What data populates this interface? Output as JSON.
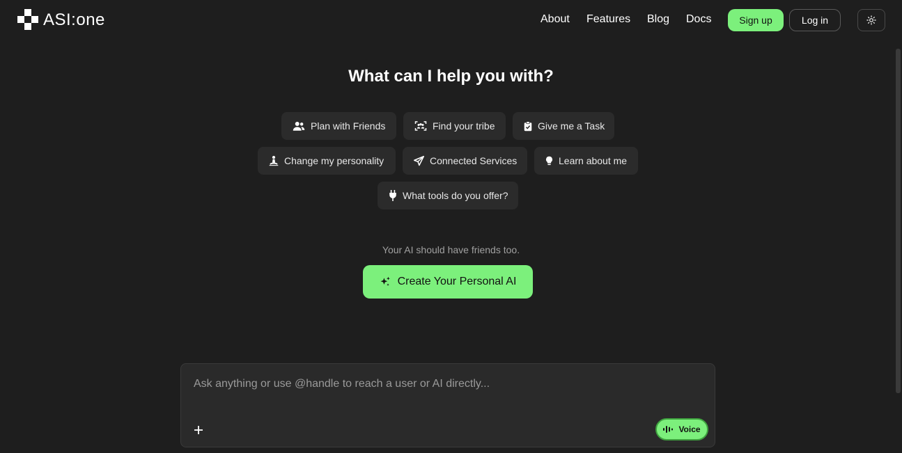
{
  "brand": {
    "name": "ASI:one"
  },
  "nav": [
    {
      "label": "About"
    },
    {
      "label": "Features"
    },
    {
      "label": "Blog"
    },
    {
      "label": "Docs"
    }
  ],
  "auth": {
    "signup": "Sign up",
    "login": "Log in"
  },
  "theme_toggle": {
    "icon": "sun-icon"
  },
  "main": {
    "heading": "What can I help you with?",
    "suggestions": [
      {
        "label": "Plan with Friends",
        "icon": "users-icon"
      },
      {
        "label": "Find your tribe",
        "icon": "scan-users-icon"
      },
      {
        "label": "Give me a Task",
        "icon": "clipboard-check-icon"
      },
      {
        "label": "Change my personality",
        "icon": "person-meditate-icon"
      },
      {
        "label": "Connected Services",
        "icon": "send-icon"
      },
      {
        "label": "Learn about me",
        "icon": "lightbulb-icon"
      },
      {
        "label": "What tools do you offer?",
        "icon": "plug-icon"
      }
    ],
    "tagline": "Your AI should have friends too.",
    "cta": "Create Your Personal AI"
  },
  "composer": {
    "placeholder": "Ask anything or use @handle to reach a user or AI directly...",
    "value": "",
    "voice_label": "Voice"
  },
  "colors": {
    "background": "#1e1e1e",
    "accent": "#7cf07c",
    "chip": "#2b2b2b",
    "composer": "#2a2a2a"
  }
}
